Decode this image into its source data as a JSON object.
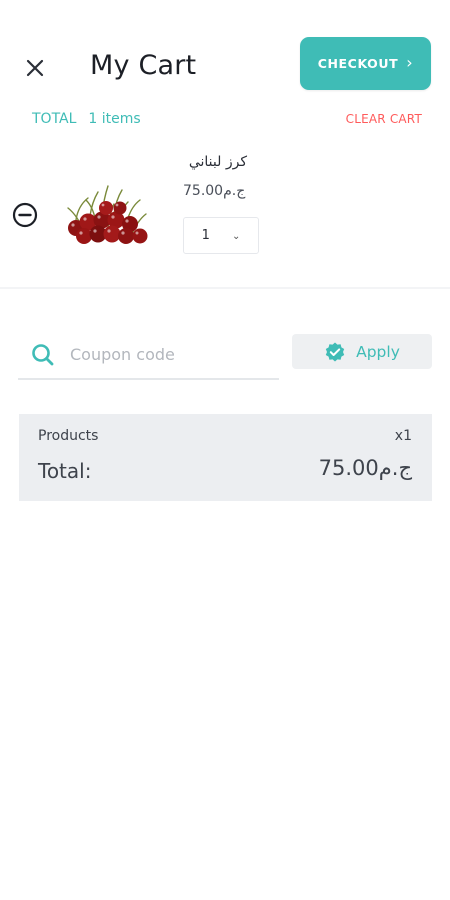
{
  "header": {
    "title": "My Cart",
    "close_icon": "close-icon",
    "checkout_label": "CHECKOUT",
    "checkout_icon": "chevron-right-icon"
  },
  "summary": {
    "total_label": "TOTAL",
    "items_text": "1 items",
    "clear_label": "CLEAR CART"
  },
  "cart_items": [
    {
      "name": "كرز لبناني",
      "price": "75.00ج.م",
      "quantity": "1",
      "image": "cherries-image"
    }
  ],
  "coupon": {
    "placeholder": "Coupon code",
    "apply_label": "Apply"
  },
  "totals": {
    "products_label": "Products",
    "products_count": "x1",
    "total_label": "Total:",
    "total_value": "75.00ج.م"
  },
  "colors": {
    "accent": "#3fbcb6",
    "danger": "#ff5b5b",
    "panel": "#eceef1"
  }
}
